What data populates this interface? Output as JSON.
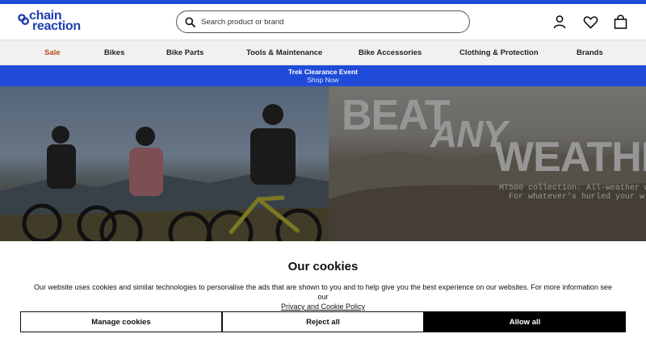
{
  "brand": {
    "logo_line1": "chain",
    "logo_line2": "reaction",
    "accent": "#1f4bd8",
    "logo_color": "#1f3fb0"
  },
  "search": {
    "placeholder": "Search product or brand",
    "value": ""
  },
  "header_icons": [
    "user-icon",
    "heart-icon",
    "bag-icon"
  ],
  "nav": {
    "items": [
      {
        "label": "Sale",
        "color": "#b34e1d"
      },
      {
        "label": "Bikes"
      },
      {
        "label": "Bike Parts"
      },
      {
        "label": "Tools & Maintenance"
      },
      {
        "label": "Bike Accessories"
      },
      {
        "label": "Clothing & Protection"
      },
      {
        "label": "Brands"
      }
    ]
  },
  "promo": {
    "title": "Trek Clearance Event",
    "link": "Shop Now"
  },
  "hero": {
    "headline_1": "BEAT",
    "headline_2": "ANY",
    "headline_3": "WEATHE",
    "line_1": "MT500 collection. All-weather w",
    "line_2": "For whatever's hurled your w"
  },
  "cookies": {
    "title": "Our cookies",
    "body": "Our website uses cookies and similar technologies to personalise the ads that are shown to you and to help give you the best experience on our websites. For more information see our",
    "policy_link": "Privacy and Cookie Policy",
    "manage_label": "Manage cookies",
    "reject_label": "Reject all",
    "allow_label": "Allow all"
  }
}
